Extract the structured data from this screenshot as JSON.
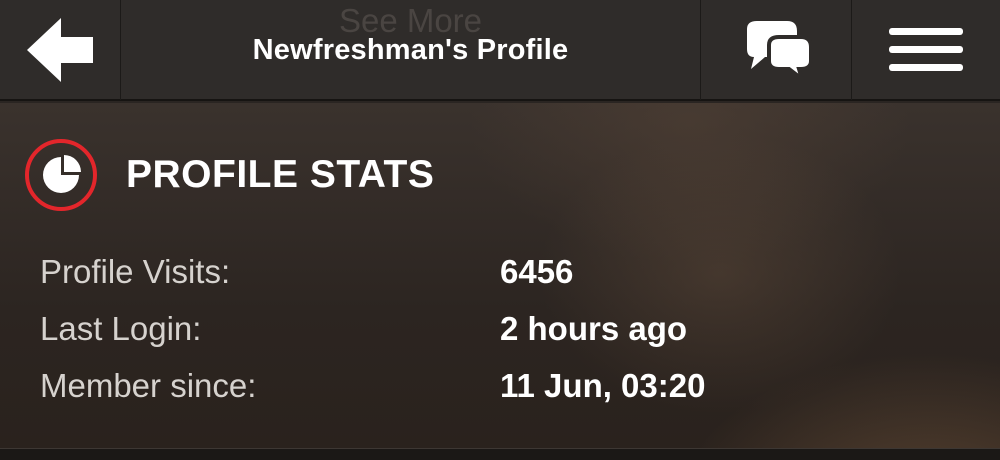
{
  "header": {
    "ghost_text": "See More",
    "title": "Newfreshman's Profile",
    "back_icon": "back-arrow-icon",
    "chat_icon": "chat-bubbles-icon",
    "menu_icon": "hamburger-menu-icon"
  },
  "section": {
    "title": "PROFILE STATS",
    "icon": "pie-chart-icon",
    "icon_ring_color": "#e3262b"
  },
  "stats": [
    {
      "label": "Profile Visits:",
      "value": "6456"
    },
    {
      "label": "Last Login:",
      "value": "2 hours ago"
    },
    {
      "label": "Member since:",
      "value": "11 Jun, 03:20"
    }
  ]
}
